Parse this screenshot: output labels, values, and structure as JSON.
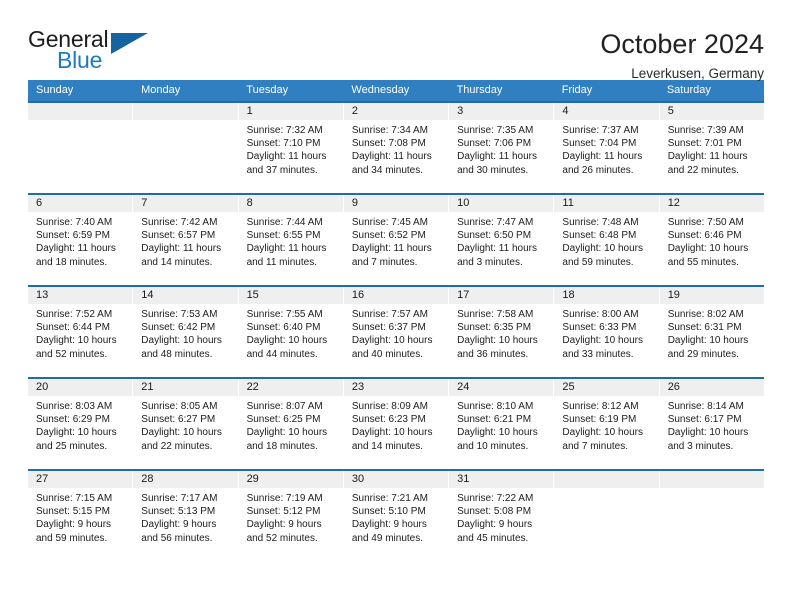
{
  "brand": {
    "word_one": "General",
    "word_two": "Blue",
    "triangle_color": "#15639f",
    "blue_color": "#1b7bc1"
  },
  "header": {
    "title": "October 2024",
    "subtitle": "Leverkusen, Germany"
  },
  "theme": {
    "header_bg": "#2f7fc1",
    "row_divider": "#1e6cab",
    "day_number_bg": "#efeff0"
  },
  "weekdays": [
    "Sunday",
    "Monday",
    "Tuesday",
    "Wednesday",
    "Thursday",
    "Friday",
    "Saturday"
  ],
  "weeks": [
    [
      {
        "day": "",
        "sunrise": "",
        "sunset": "",
        "daylight": "",
        "empty": true
      },
      {
        "day": "",
        "sunrise": "",
        "sunset": "",
        "daylight": "",
        "empty": true
      },
      {
        "day": "1",
        "sunrise": "Sunrise: 7:32 AM",
        "sunset": "Sunset: 7:10 PM",
        "daylight": "Daylight: 11 hours and 37 minutes."
      },
      {
        "day": "2",
        "sunrise": "Sunrise: 7:34 AM",
        "sunset": "Sunset: 7:08 PM",
        "daylight": "Daylight: 11 hours and 34 minutes."
      },
      {
        "day": "3",
        "sunrise": "Sunrise: 7:35 AM",
        "sunset": "Sunset: 7:06 PM",
        "daylight": "Daylight: 11 hours and 30 minutes."
      },
      {
        "day": "4",
        "sunrise": "Sunrise: 7:37 AM",
        "sunset": "Sunset: 7:04 PM",
        "daylight": "Daylight: 11 hours and 26 minutes."
      },
      {
        "day": "5",
        "sunrise": "Sunrise: 7:39 AM",
        "sunset": "Sunset: 7:01 PM",
        "daylight": "Daylight: 11 hours and 22 minutes."
      }
    ],
    [
      {
        "day": "6",
        "sunrise": "Sunrise: 7:40 AM",
        "sunset": "Sunset: 6:59 PM",
        "daylight": "Daylight: 11 hours and 18 minutes."
      },
      {
        "day": "7",
        "sunrise": "Sunrise: 7:42 AM",
        "sunset": "Sunset: 6:57 PM",
        "daylight": "Daylight: 11 hours and 14 minutes."
      },
      {
        "day": "8",
        "sunrise": "Sunrise: 7:44 AM",
        "sunset": "Sunset: 6:55 PM",
        "daylight": "Daylight: 11 hours and 11 minutes."
      },
      {
        "day": "9",
        "sunrise": "Sunrise: 7:45 AM",
        "sunset": "Sunset: 6:52 PM",
        "daylight": "Daylight: 11 hours and 7 minutes."
      },
      {
        "day": "10",
        "sunrise": "Sunrise: 7:47 AM",
        "sunset": "Sunset: 6:50 PM",
        "daylight": "Daylight: 11 hours and 3 minutes."
      },
      {
        "day": "11",
        "sunrise": "Sunrise: 7:48 AM",
        "sunset": "Sunset: 6:48 PM",
        "daylight": "Daylight: 10 hours and 59 minutes."
      },
      {
        "day": "12",
        "sunrise": "Sunrise: 7:50 AM",
        "sunset": "Sunset: 6:46 PM",
        "daylight": "Daylight: 10 hours and 55 minutes."
      }
    ],
    [
      {
        "day": "13",
        "sunrise": "Sunrise: 7:52 AM",
        "sunset": "Sunset: 6:44 PM",
        "daylight": "Daylight: 10 hours and 52 minutes."
      },
      {
        "day": "14",
        "sunrise": "Sunrise: 7:53 AM",
        "sunset": "Sunset: 6:42 PM",
        "daylight": "Daylight: 10 hours and 48 minutes."
      },
      {
        "day": "15",
        "sunrise": "Sunrise: 7:55 AM",
        "sunset": "Sunset: 6:40 PM",
        "daylight": "Daylight: 10 hours and 44 minutes."
      },
      {
        "day": "16",
        "sunrise": "Sunrise: 7:57 AM",
        "sunset": "Sunset: 6:37 PM",
        "daylight": "Daylight: 10 hours and 40 minutes."
      },
      {
        "day": "17",
        "sunrise": "Sunrise: 7:58 AM",
        "sunset": "Sunset: 6:35 PM",
        "daylight": "Daylight: 10 hours and 36 minutes."
      },
      {
        "day": "18",
        "sunrise": "Sunrise: 8:00 AM",
        "sunset": "Sunset: 6:33 PM",
        "daylight": "Daylight: 10 hours and 33 minutes."
      },
      {
        "day": "19",
        "sunrise": "Sunrise: 8:02 AM",
        "sunset": "Sunset: 6:31 PM",
        "daylight": "Daylight: 10 hours and 29 minutes."
      }
    ],
    [
      {
        "day": "20",
        "sunrise": "Sunrise: 8:03 AM",
        "sunset": "Sunset: 6:29 PM",
        "daylight": "Daylight: 10 hours and 25 minutes."
      },
      {
        "day": "21",
        "sunrise": "Sunrise: 8:05 AM",
        "sunset": "Sunset: 6:27 PM",
        "daylight": "Daylight: 10 hours and 22 minutes."
      },
      {
        "day": "22",
        "sunrise": "Sunrise: 8:07 AM",
        "sunset": "Sunset: 6:25 PM",
        "daylight": "Daylight: 10 hours and 18 minutes."
      },
      {
        "day": "23",
        "sunrise": "Sunrise: 8:09 AM",
        "sunset": "Sunset: 6:23 PM",
        "daylight": "Daylight: 10 hours and 14 minutes."
      },
      {
        "day": "24",
        "sunrise": "Sunrise: 8:10 AM",
        "sunset": "Sunset: 6:21 PM",
        "daylight": "Daylight: 10 hours and 10 minutes."
      },
      {
        "day": "25",
        "sunrise": "Sunrise: 8:12 AM",
        "sunset": "Sunset: 6:19 PM",
        "daylight": "Daylight: 10 hours and 7 minutes."
      },
      {
        "day": "26",
        "sunrise": "Sunrise: 8:14 AM",
        "sunset": "Sunset: 6:17 PM",
        "daylight": "Daylight: 10 hours and 3 minutes."
      }
    ],
    [
      {
        "day": "27",
        "sunrise": "Sunrise: 7:15 AM",
        "sunset": "Sunset: 5:15 PM",
        "daylight": "Daylight: 9 hours and 59 minutes."
      },
      {
        "day": "28",
        "sunrise": "Sunrise: 7:17 AM",
        "sunset": "Sunset: 5:13 PM",
        "daylight": "Daylight: 9 hours and 56 minutes."
      },
      {
        "day": "29",
        "sunrise": "Sunrise: 7:19 AM",
        "sunset": "Sunset: 5:12 PM",
        "daylight": "Daylight: 9 hours and 52 minutes."
      },
      {
        "day": "30",
        "sunrise": "Sunrise: 7:21 AM",
        "sunset": "Sunset: 5:10 PM",
        "daylight": "Daylight: 9 hours and 49 minutes."
      },
      {
        "day": "31",
        "sunrise": "Sunrise: 7:22 AM",
        "sunset": "Sunset: 5:08 PM",
        "daylight": "Daylight: 9 hours and 45 minutes."
      },
      {
        "day": "",
        "sunrise": "",
        "sunset": "",
        "daylight": "",
        "empty": true
      },
      {
        "day": "",
        "sunrise": "",
        "sunset": "",
        "daylight": "",
        "empty": true
      }
    ]
  ]
}
